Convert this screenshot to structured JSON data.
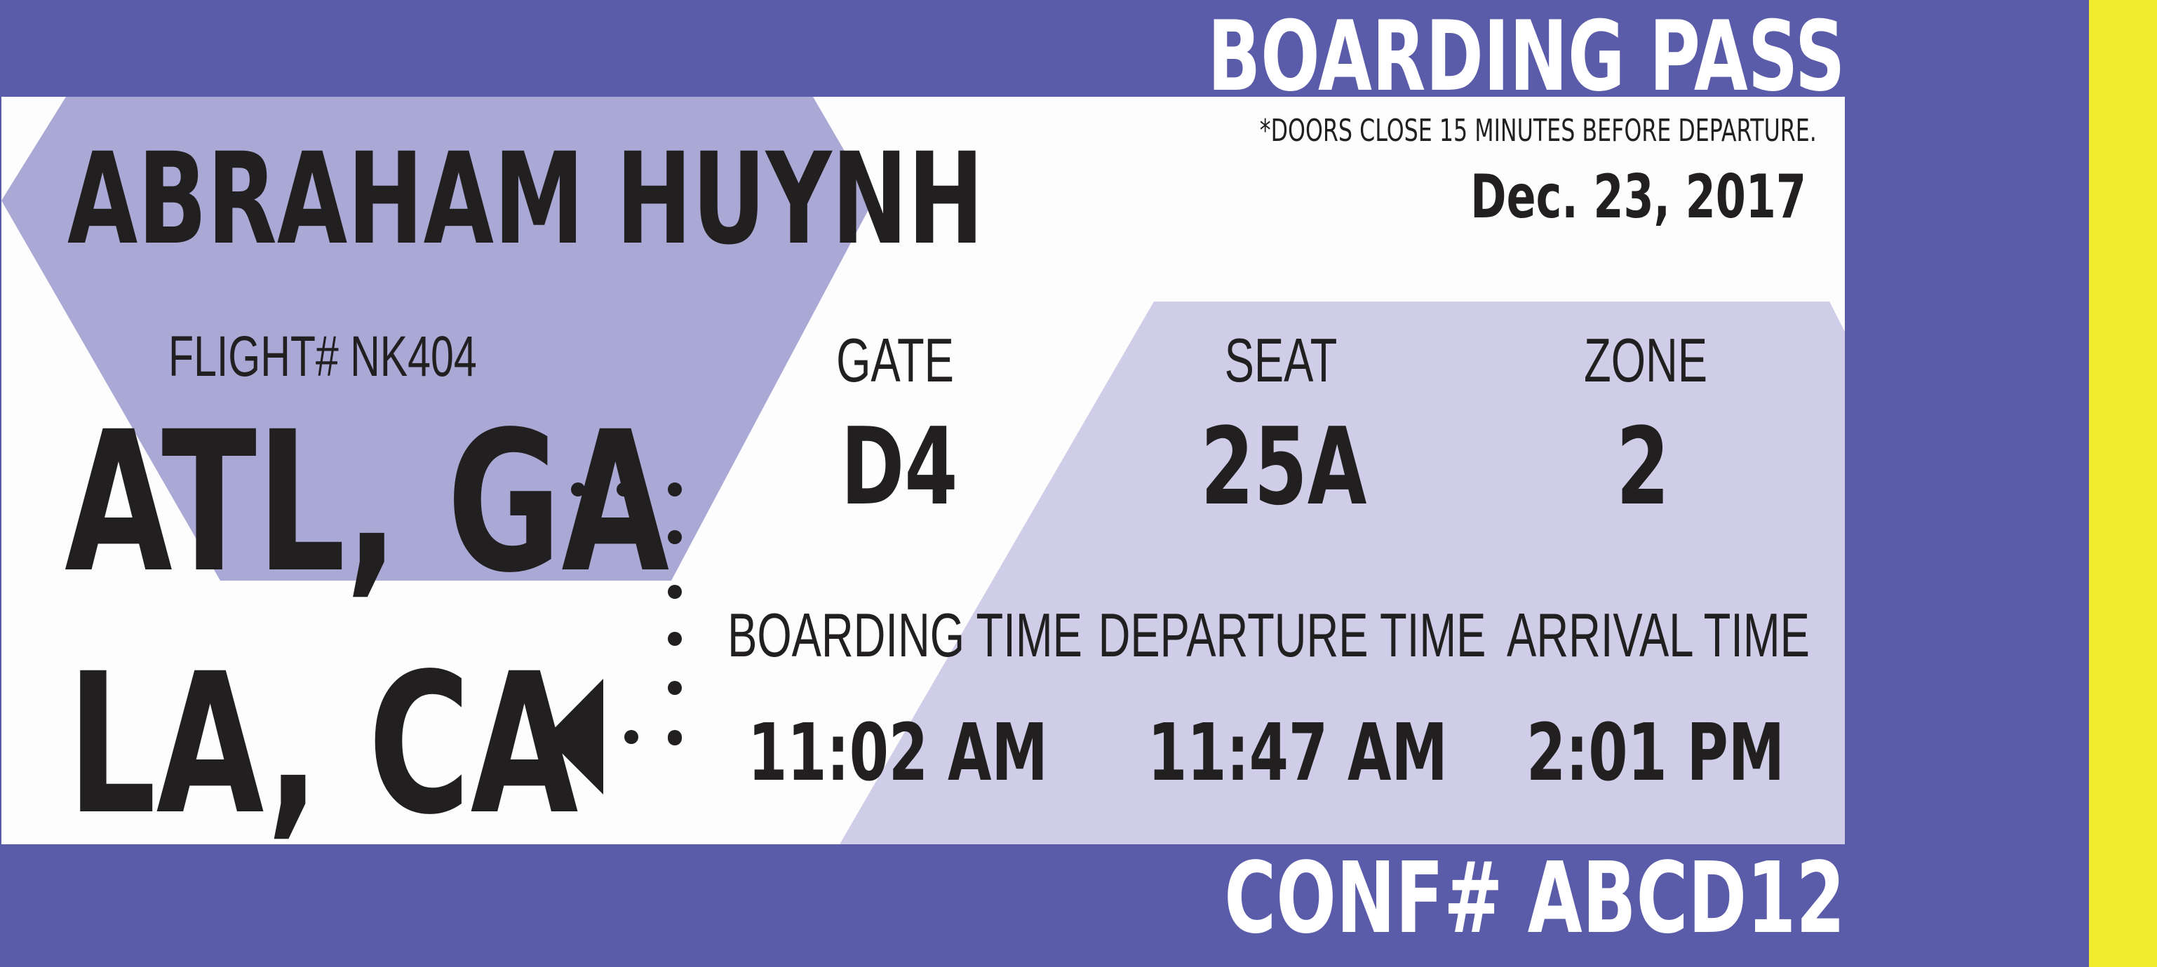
{
  "header": {
    "title": "BOARDING PASS"
  },
  "notice": "*DOORS CLOSE 15 MINUTES BEFORE DEPARTURE.",
  "date": "Dec. 23, 2017",
  "passenger": "ABRAHAM HUYNH",
  "flight": "FLIGHT# NK404",
  "route": {
    "origin": "ATL, GA",
    "destination": "LA, CA"
  },
  "gate": {
    "label": "GATE",
    "value": "D4"
  },
  "seat": {
    "label": "SEAT",
    "value": "25A"
  },
  "zone": {
    "label": "ZONE",
    "value": "2"
  },
  "boarding_time": {
    "label": "BOARDING TIME",
    "value": "11:02 AM"
  },
  "departure_time": {
    "label": "DEPARTURE TIME",
    "value": "11:47 AM"
  },
  "arrival_time": {
    "label": "ARRIVAL TIME",
    "value": "2:01 PM"
  },
  "confirmation": "CONF# ABCD12",
  "colors": {
    "band": "#5a5ca9",
    "hexagon": "#aaa8d5",
    "info_panel": "#cfcde7",
    "stub": "#f2ec2e",
    "text": "#221f20"
  }
}
